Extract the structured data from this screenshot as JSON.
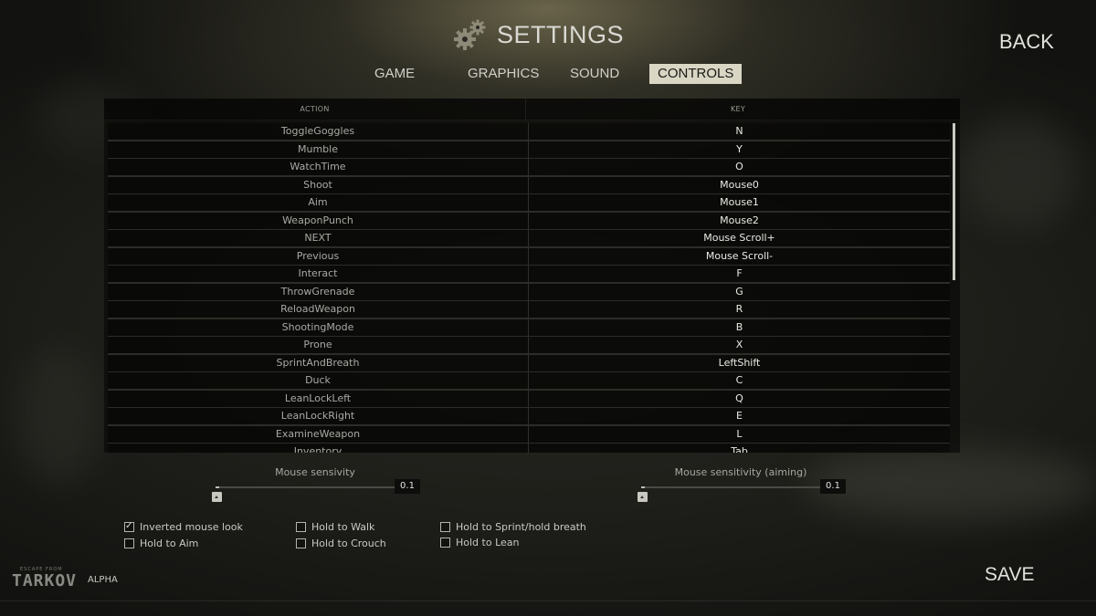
{
  "header": {
    "title": "SETTINGS",
    "back_label": "BACK"
  },
  "tabs": [
    {
      "label": "GAME",
      "active": false
    },
    {
      "label": "GRAPHICS",
      "active": false
    },
    {
      "label": "SOUND",
      "active": false
    },
    {
      "label": "CONTROLS",
      "active": true
    }
  ],
  "table": {
    "headers": {
      "action": "ACTION",
      "key": "KEY"
    },
    "rows": [
      {
        "action": "ToggleGoggles",
        "key": "N"
      },
      {
        "action": "Mumble",
        "key": "Y"
      },
      {
        "action": "WatchTime",
        "key": "O"
      },
      {
        "action": "Shoot",
        "key": "Mouse0"
      },
      {
        "action": "Aim",
        "key": "Mouse1"
      },
      {
        "action": "WeaponPunch",
        "key": "Mouse2"
      },
      {
        "action": "NEXT",
        "key": "Mouse Scroll+"
      },
      {
        "action": "Previous",
        "key": "Mouse Scroll-"
      },
      {
        "action": "Interact",
        "key": "F"
      },
      {
        "action": "ThrowGrenade",
        "key": "G"
      },
      {
        "action": "ReloadWeapon",
        "key": "R"
      },
      {
        "action": "ShootingMode",
        "key": "B"
      },
      {
        "action": "Prone",
        "key": "X"
      },
      {
        "action": "SprintAndBreath",
        "key": "LeftShift"
      },
      {
        "action": "Duck",
        "key": "C"
      },
      {
        "action": "LeanLockLeft",
        "key": "Q"
      },
      {
        "action": "LeanLockRight",
        "key": "E"
      },
      {
        "action": "ExamineWeapon",
        "key": "L"
      },
      {
        "action": "Inventory",
        "key": "Tab"
      }
    ],
    "scroll_position": 0
  },
  "sliders": {
    "mouse_sensitivity": {
      "label": "Mouse sensivity",
      "value": "0.1"
    },
    "mouse_sensitivity_aiming": {
      "label": "Mouse sensitivity (aiming)",
      "value": "0.1"
    }
  },
  "options": {
    "inverted_mouse": {
      "label": "Inverted mouse look",
      "checked": true
    },
    "hold_to_aim": {
      "label": "Hold to Aim",
      "checked": false
    },
    "hold_to_walk": {
      "label": "Hold to Walk",
      "checked": false
    },
    "hold_to_crouch": {
      "label": "Hold to Crouch",
      "checked": false
    },
    "hold_to_sprint": {
      "label": "Hold to Sprint/hold breath",
      "checked": false
    },
    "hold_to_lean": {
      "label": "Hold to Lean",
      "checked": false
    }
  },
  "footer": {
    "logo_top": "ESCAPE FROM",
    "logo_main": "TARKOV",
    "build_label": "ALPHA",
    "save_label": "SAVE"
  },
  "colors": {
    "active_tab_bg": "#d9d6c4",
    "background": "#1c1c18",
    "text": "#d8d8d2"
  }
}
